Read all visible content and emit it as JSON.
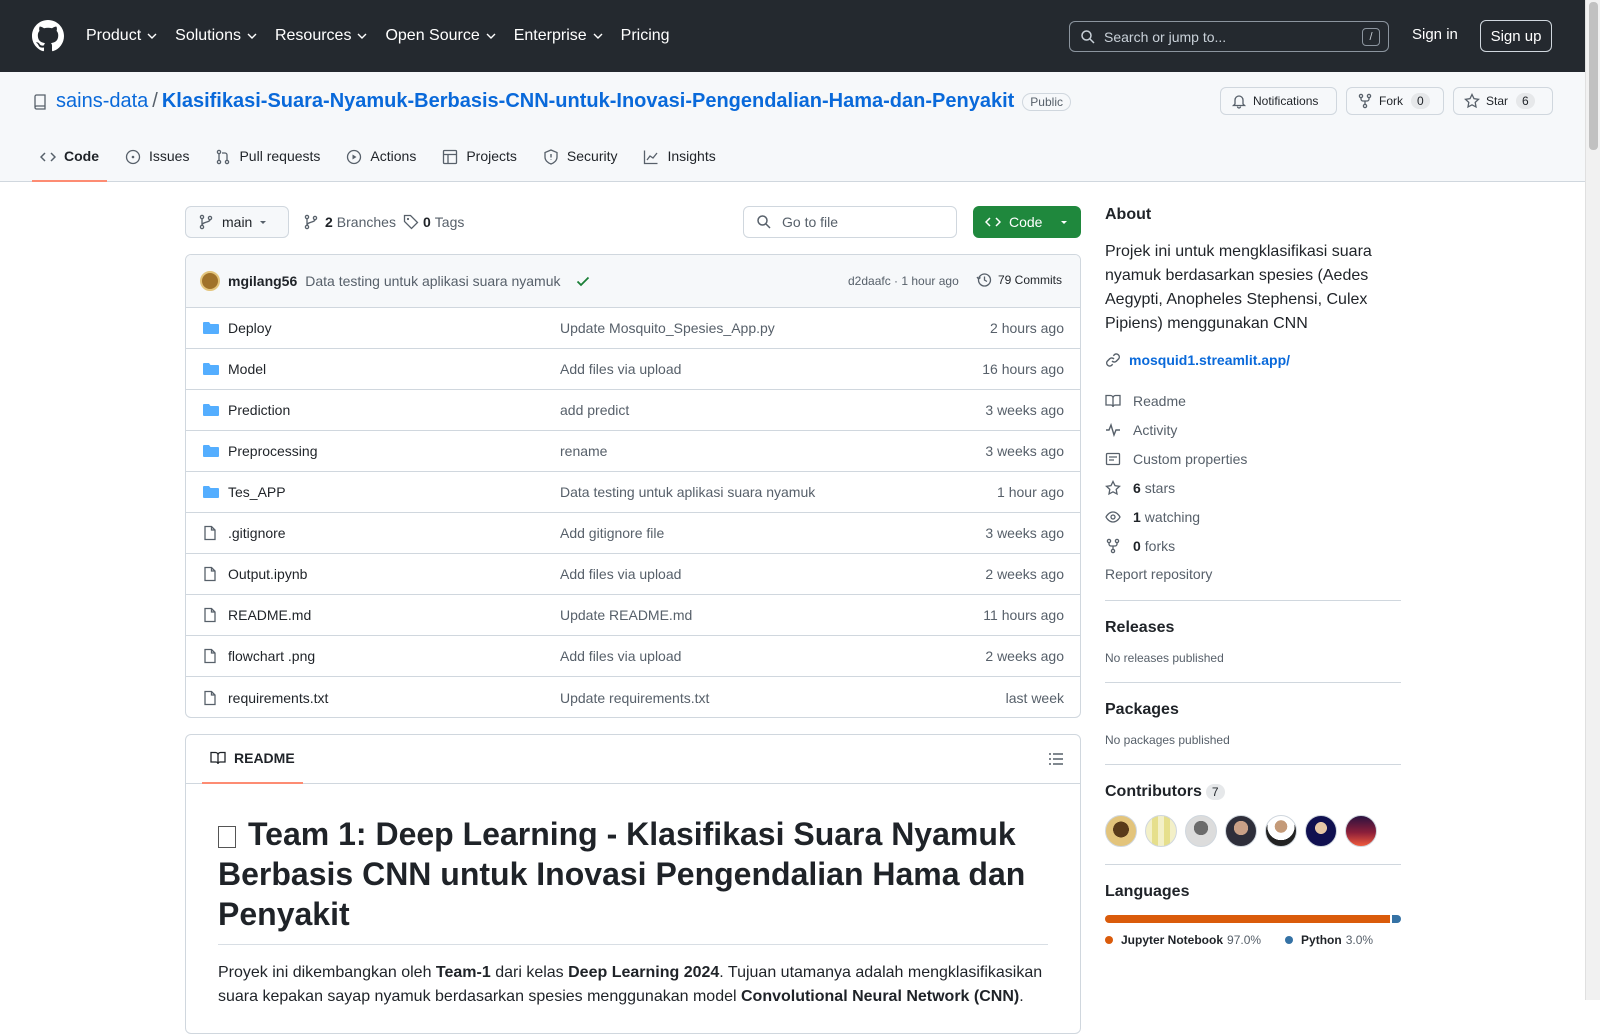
{
  "topnav": {
    "items": [
      "Product",
      "Solutions",
      "Resources",
      "Open Source",
      "Enterprise",
      "Pricing"
    ],
    "search_placeholder": "Search or jump to...",
    "search_shortcut": "/",
    "signin": "Sign in",
    "signup": "Sign up"
  },
  "repo": {
    "owner": "sains-data",
    "separator": "/",
    "name": "Klasifikasi-Suara-Nyamuk-Berbasis-CNN-untuk-Inovasi-Pengendalian-Hama-dan-Penyakit",
    "visibility": "Public",
    "notifications": "Notifications",
    "fork_label": "Fork",
    "fork_count": "0",
    "star_label": "Star",
    "star_count": "6"
  },
  "tabs": [
    "Code",
    "Issues",
    "Pull requests",
    "Actions",
    "Projects",
    "Security",
    "Insights"
  ],
  "toolbar": {
    "branch": "main",
    "branches_count": "2",
    "branches_label": "Branches",
    "tags_count": "0",
    "tags_label": "Tags",
    "goto_placeholder": "Go to file",
    "code_button": "Code"
  },
  "commit": {
    "author": "mgilang56",
    "message": "Data testing untuk aplikasi suara nyamuk",
    "meta": "d2daafc · 1 hour ago",
    "commits": "79 Commits"
  },
  "files": [
    {
      "type": "dir",
      "name": "Deploy",
      "message": "Update Mosquito_Spesies_App.py",
      "time": "2 hours ago"
    },
    {
      "type": "dir",
      "name": "Model",
      "message": "Add files via upload",
      "time": "16 hours ago"
    },
    {
      "type": "dir",
      "name": "Prediction",
      "message": "add predict",
      "time": "3 weeks ago"
    },
    {
      "type": "dir",
      "name": "Preprocessing",
      "message": "rename",
      "time": "3 weeks ago"
    },
    {
      "type": "dir",
      "name": "Tes_APP",
      "message": "Data testing untuk aplikasi suara nyamuk",
      "time": "1 hour ago"
    },
    {
      "type": "file",
      "name": ".gitignore",
      "message": "Add gitignore file",
      "time": "3 weeks ago"
    },
    {
      "type": "file",
      "name": "Output.ipynb",
      "message": "Add files via upload",
      "time": "2 weeks ago"
    },
    {
      "type": "file",
      "name": "README.md",
      "message": "Update README.md",
      "time": "11 hours ago"
    },
    {
      "type": "file",
      "name": "flowchart .png",
      "message": "Add files via upload",
      "time": "2 weeks ago"
    },
    {
      "type": "file",
      "name": "requirements.txt",
      "message": "Update requirements.txt",
      "time": "last week"
    }
  ],
  "readme": {
    "label": "README",
    "title": "Team 1: Deep Learning - Klasifikasi Suara Nyamuk Berbasis CNN untuk Inovasi Pengendalian Hama dan Penyakit",
    "intro_1": "Proyek ini dikembangkan oleh ",
    "intro_team": "Team-1",
    "intro_2": " dari kelas ",
    "intro_class": "Deep Learning 2024",
    "intro_3": ". Tujuan utamanya adalah mengklasifikasikan suara kepakan sayap nyamuk berdasarkan spesies menggunakan model ",
    "intro_model": "Convolutional Neural Network (CNN)",
    "intro_4": "."
  },
  "about": {
    "heading": "About",
    "description": "Projek ini untuk mengklasifikasi suara nyamuk berdasarkan spesies (Aedes Aegypti, Anopheles Stephensi, Culex Pipiens) menggunakan CNN",
    "link": "mosquid1.streamlit.app/",
    "readme": "Readme",
    "activity": "Activity",
    "custom_properties": "Custom properties",
    "stars_count": "6",
    "stars_label": "stars",
    "watching_count": "1",
    "watching_label": "watching",
    "forks_count": "0",
    "forks_label": "forks",
    "report": "Report repository"
  },
  "releases": {
    "heading": "Releases",
    "text": "No releases published"
  },
  "packages": {
    "heading": "Packages",
    "text": "No packages published"
  },
  "contributors": {
    "heading": "Contributors",
    "count": "7"
  },
  "languages": {
    "heading": "Languages",
    "items": [
      {
        "name": "Jupyter Notebook",
        "pct": "97.0%",
        "value": 97.0,
        "color": "#DA5B0B"
      },
      {
        "name": "Python",
        "pct": "3.0%",
        "value": 3.0,
        "color": "#3572A5"
      }
    ]
  },
  "colors": {
    "accent": "#0969da",
    "code_button": "#1f883d",
    "header_bg": "#24292f",
    "tab_underline": "#fd8c73"
  }
}
